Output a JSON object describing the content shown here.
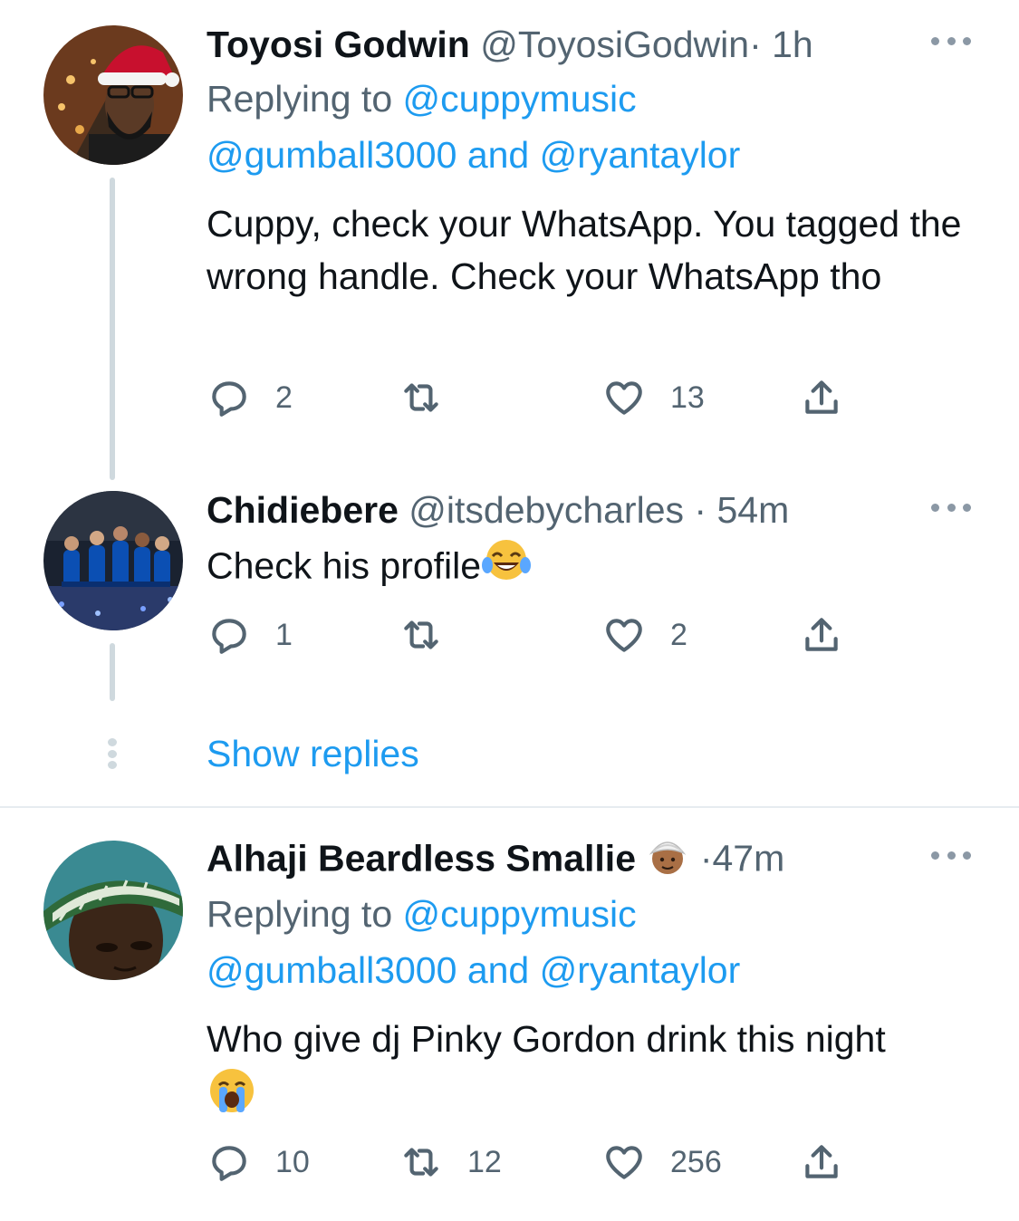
{
  "tweets": [
    {
      "name": "Toyosi Godwin",
      "handle": "@ToyosiGodwin",
      "separator": "·",
      "time": "1h",
      "replying_prefix": "Replying to ",
      "replying_to_1": "@cuppymusic",
      "replying_to_2": "@gumball3000",
      "replying_and": " and ",
      "replying_to_3": "@ryantaylor",
      "text": "Cuppy, check your WhatsApp. You tagged the wrong handle. Check your WhatsApp tho",
      "replies": "2",
      "retweets": "",
      "likes": "13",
      "avatar_icon": "santa-hat-avatar"
    },
    {
      "name": "Chidiebere",
      "handle": "@itsdebycharles",
      "separator": "·",
      "time": "54m",
      "text": "Check his profile",
      "text_emoji": "face-with-tears-of-joy",
      "replies": "1",
      "retweets": "",
      "likes": "2",
      "avatar_icon": "football-team-avatar"
    },
    {
      "name": "Alhaji Beardless Smallie",
      "name_emoji": "person-wearing-turban",
      "handle": "",
      "separator": "·",
      "time": "47m",
      "replying_prefix": "Replying to ",
      "replying_to_1": "@cuppymusic",
      "replying_to_2": "@gumball3000",
      "replying_and": " and ",
      "replying_to_3": "@ryantaylor",
      "text": "Who give dj Pinky Gordon drink this night",
      "text_emoji": "loudly-crying-face",
      "replies": "10",
      "retweets": "12",
      "likes": "256",
      "avatar_icon": "cap-avatar"
    }
  ],
  "show_replies": "Show replies",
  "colors": {
    "link": "#1d9bf0",
    "secondary_text": "#536471",
    "thread_line": "#cfd9de",
    "divider": "#e6ecf0"
  }
}
